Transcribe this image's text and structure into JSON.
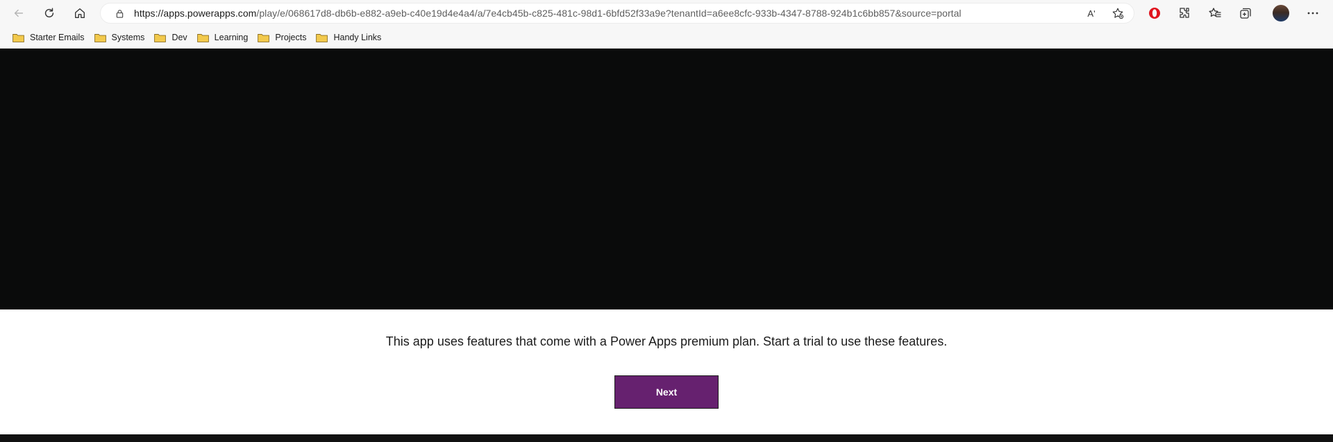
{
  "browser": {
    "url_host": "https://apps.powerapps.com",
    "url_path": "/play/e/068617d8-db6b-e882-a9eb-c40e19d4e4a4/a/7e4cb45b-c825-481c-98d1-6bfd52f33a9e?tenantId=a6ee8cfc-933b-4347-8788-924b1c6bb857&source=portal",
    "read_aloud_glyph": "Aʹ",
    "bookmarks": [
      {
        "label": "Starter Emails"
      },
      {
        "label": "Systems"
      },
      {
        "label": "Dev"
      },
      {
        "label": "Learning"
      },
      {
        "label": "Projects"
      },
      {
        "label": "Handy Links"
      }
    ]
  },
  "app": {
    "message": "This app uses features that come with a Power Apps premium plan. Start a trial to use these features.",
    "next_label": "Next"
  },
  "colors": {
    "accent": "#66216f",
    "dark_panel": "#0a0b0b",
    "folder": "#f2c94c"
  }
}
